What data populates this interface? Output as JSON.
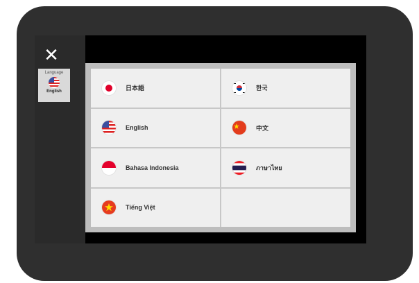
{
  "dialog": {
    "close_icon": "close-icon"
  },
  "sidebar": {
    "tab_label": "Language",
    "current_language": "English"
  },
  "languages": [
    {
      "label": "日本語",
      "flag": "japan-flag-icon"
    },
    {
      "label": "한국",
      "flag": "korea-flag-icon"
    },
    {
      "label": "English",
      "flag": "usa-flag-icon"
    },
    {
      "label": "中文",
      "flag": "china-flag-icon"
    },
    {
      "label": "Bahasa Indonesia",
      "flag": "indonesia-flag-icon"
    },
    {
      "label": "ภาษาไทย",
      "flag": "thailand-flag-icon"
    },
    {
      "label": "Tiếng Việt",
      "flag": "vietnam-flag-icon"
    }
  ]
}
